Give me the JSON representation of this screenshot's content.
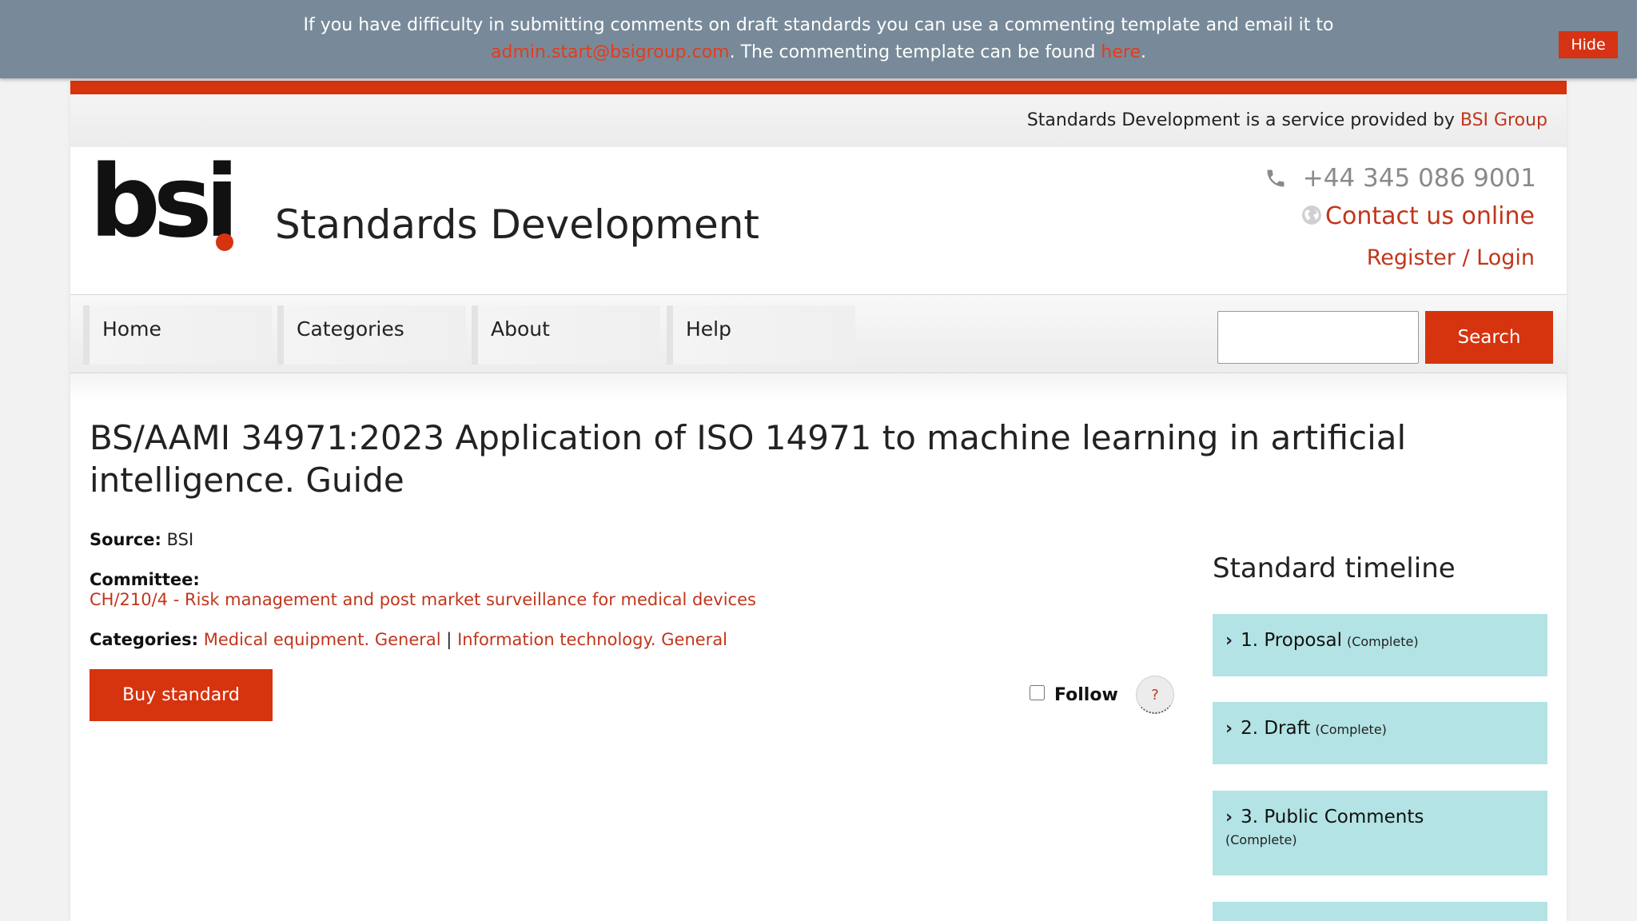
{
  "notice": {
    "line1": "If you have difficulty in submitting comments on draft standards you can use a commenting template and email it to",
    "email": "admin.start@bsigroup.com",
    "line2_mid": ". The commenting template can be found ",
    "here_link": "here",
    "line2_end": ".",
    "hide_label": "Hide"
  },
  "topstrip": {
    "text": "Standards Development is a service provided by ",
    "link": "BSI Group"
  },
  "header": {
    "logo_text": "bsi",
    "site_title": "Standards Development",
    "phone": "+44 345 086 9001",
    "contact_online": "Contact us online",
    "register_login": "Register / Login"
  },
  "nav": {
    "items": [
      {
        "label": "Home"
      },
      {
        "label": "Categories"
      },
      {
        "label": "About"
      },
      {
        "label": "Help"
      }
    ],
    "search_value": "",
    "search_button": "Search"
  },
  "standard": {
    "title": "BS/AAMI 34971:2023 Application of ISO 14971 to machine learning in artificial intelligence. Guide",
    "source_label": "Source:",
    "source_value": "BSI",
    "committee_label": "Committee:",
    "committee_value": "CH/210/4 - Risk management and post market surveillance for medical devices",
    "categories_label": "Categories:",
    "categories": [
      "Medical equipment. General",
      "Information technology. General"
    ],
    "category_separator": "|",
    "buy_button": "Buy standard",
    "follow_label": "Follow",
    "follow_checked": false,
    "help_label": "?"
  },
  "timeline": {
    "title": "Standard timeline",
    "items": [
      {
        "label": "1. Proposal",
        "status": "(Complete)"
      },
      {
        "label": "2. Draft",
        "status": "(Complete)"
      },
      {
        "label": "3. Public Comments",
        "status": "(Complete)"
      }
    ]
  },
  "colors": {
    "brand_red": "#d6330f",
    "link_red": "#c0361b",
    "notice_bg": "#788a99",
    "timeline_bg": "#b3e3e4"
  }
}
